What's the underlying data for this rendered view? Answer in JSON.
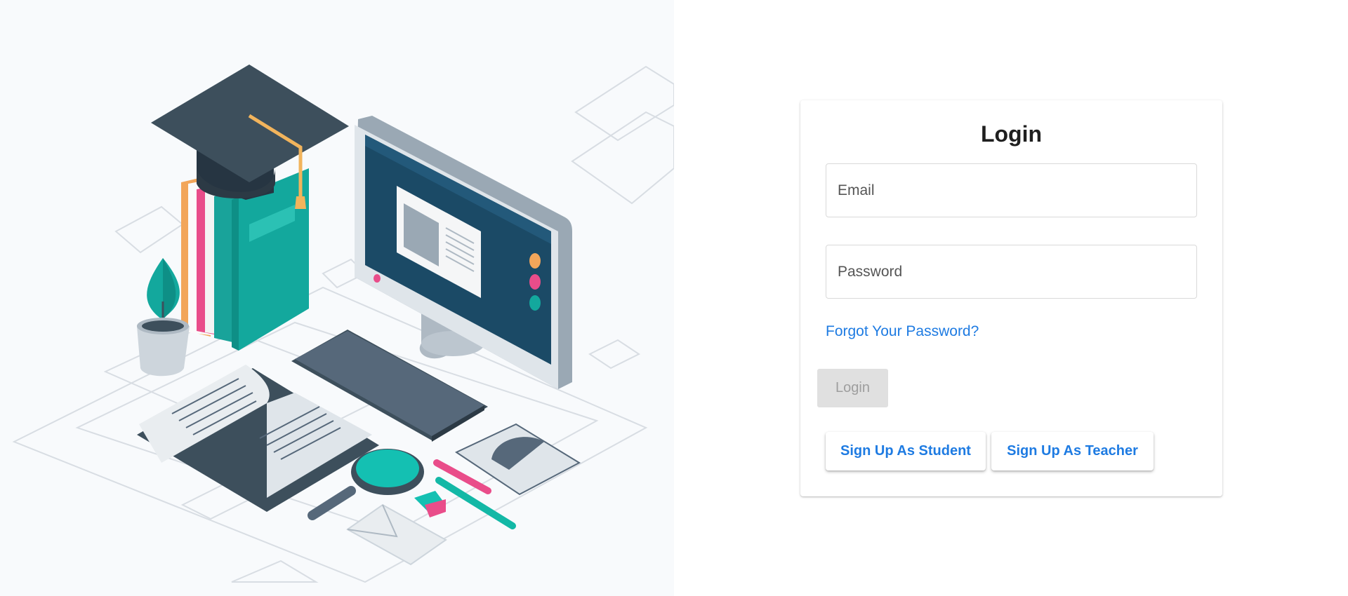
{
  "login_card": {
    "title": "Login",
    "email_placeholder": "Email",
    "password_placeholder": "Password",
    "forgot_password": "Forgot Your Password?",
    "login_button": "Login",
    "signup_student": "Sign Up As Student",
    "signup_teacher": "Sign Up As Teacher"
  },
  "colors": {
    "link": "#1e7be2",
    "disabled_button_bg": "#e0e0e0",
    "illustration_teal": "#14b8a6",
    "illustration_navy": "#1b4a66"
  },
  "illustration": {
    "description_icons": [
      "graduation-cap-icon",
      "books-icon",
      "monitor-icon",
      "keyboard-icon",
      "book-icon",
      "magnifier-icon",
      "mouse-icon",
      "pencil-icon",
      "envelope-icon",
      "plant-icon"
    ]
  }
}
